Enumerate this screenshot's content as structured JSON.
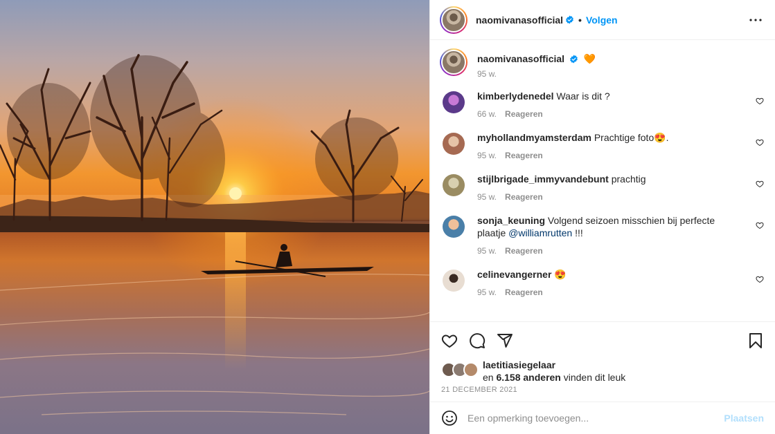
{
  "header": {
    "username": "naomivanasofficial",
    "separator": "•",
    "follow_label": "Volgen",
    "verified_icon": "verified-badge-icon",
    "more_icon": "more-options-icon"
  },
  "caption": {
    "username": "naomivanasofficial",
    "text": "🧡",
    "time": "95 w."
  },
  "reply_label": "Reageren",
  "comments": [
    {
      "username": "kimberlydenedel",
      "text": "Waar is dit ?",
      "time": "66 w.",
      "avatar_color": "#5b3a8a"
    },
    {
      "username": "myhollandmyamsterdam",
      "text": "Prachtige foto😍.",
      "time": "95 w.",
      "avatar_color": "#a66a52"
    },
    {
      "username": "stijlbrigade_immyvandebunt",
      "text": "prachtig",
      "time": "95 w.",
      "avatar_color": "#9a8c62"
    },
    {
      "username": "sonja_keuning",
      "text": "Volgend seizoen misschien bij perfecte plaatje",
      "mention": "@williamrutten",
      "text_after": "!!!",
      "time": "95 w.",
      "avatar_color": "#4a7fa8"
    },
    {
      "username": "celinevangerner",
      "text": "😍",
      "time": "95 w.",
      "avatar_color": "#e8ddd2"
    }
  ],
  "likes": {
    "first_liker": "laetitiasiegelaar",
    "prefix": "en",
    "count_text": "6.158 anderen",
    "suffix": "vinden dit leuk"
  },
  "date": "21 DECEMBER 2021",
  "add_comment": {
    "placeholder": "Een opmerking toevoegen...",
    "post_label": "Plaatsen"
  },
  "colors": {
    "accent": "#0095f6",
    "link": "#00376b",
    "muted": "#8e8e8e",
    "post_disabled": "#b2dffc"
  }
}
